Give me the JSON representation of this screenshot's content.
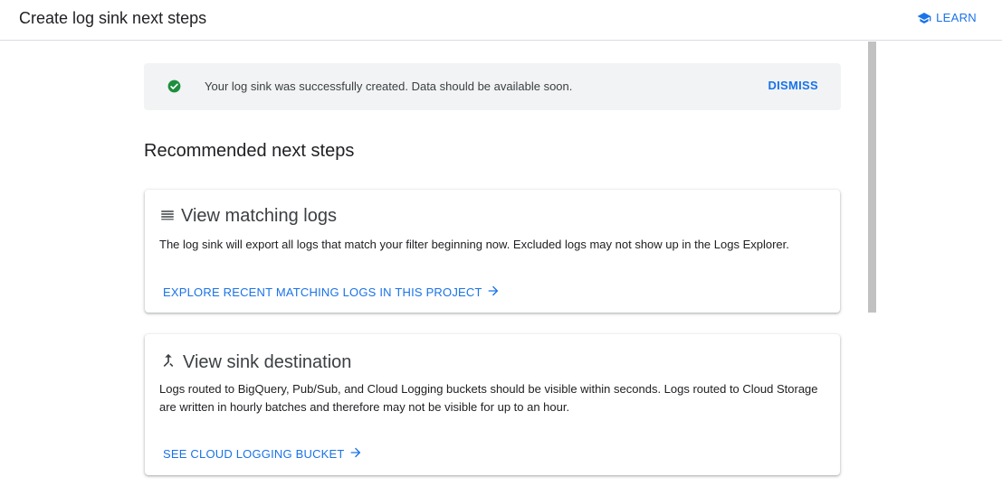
{
  "header": {
    "title": "Create log sink next steps",
    "learn_label": "LEARN"
  },
  "banner": {
    "message": "Your log sink was successfully created. Data should be available soon.",
    "dismiss_label": "DISMISS"
  },
  "section": {
    "title": "Recommended next steps"
  },
  "cards": [
    {
      "title": "View matching logs",
      "description": "The log sink will export all logs that match your filter beginning now. Excluded logs may not show up in the Logs Explorer.",
      "link_label": "EXPLORE RECENT MATCHING LOGS IN THIS PROJECT",
      "icon": "list-icon"
    },
    {
      "title": "View sink destination",
      "description": "Logs routed to BigQuery, Pub/Sub, and Cloud Logging buckets should be visible within seconds. Logs routed to Cloud Storage are written in hourly batches and therefore may not be visible for up to an hour.",
      "link_label": "SEE CLOUD LOGGING BUCKET",
      "icon": "merge-icon"
    }
  ],
  "colors": {
    "accent": "#1a73e8",
    "success": "#1e8e3e",
    "banner_bg": "#f1f3f4"
  }
}
